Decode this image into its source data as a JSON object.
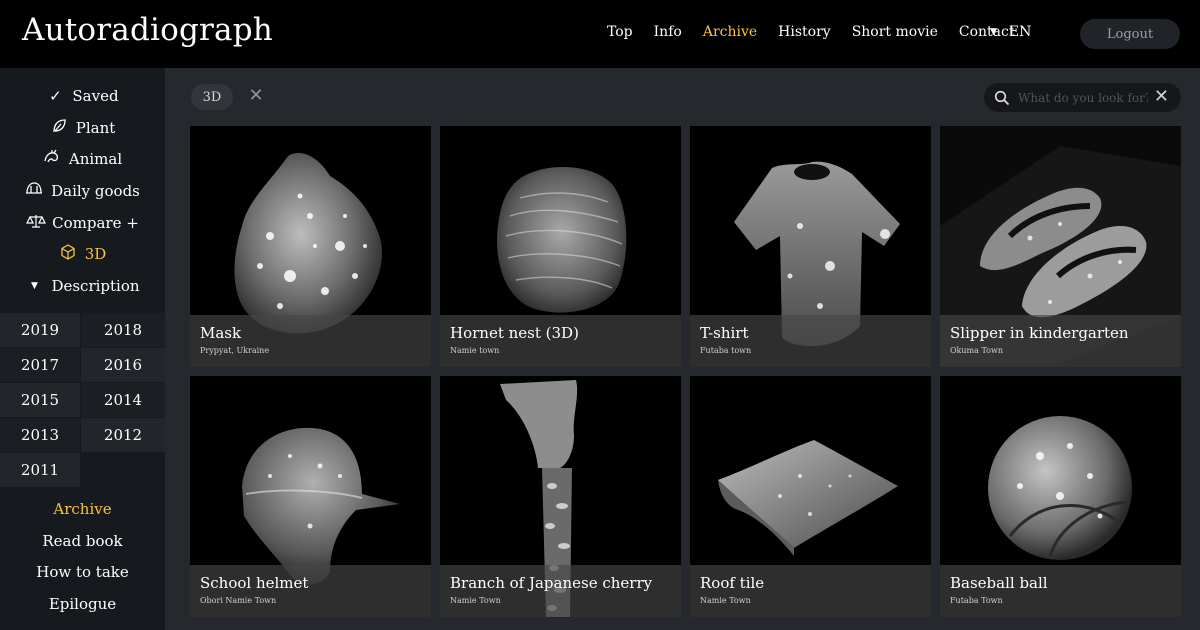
{
  "header": {
    "logo": "Autoradiograph",
    "nav": [
      "Top",
      "Info",
      "Archive",
      "History",
      "Short movie",
      "Contact"
    ],
    "active_nav": "Archive",
    "lang": "EN",
    "logout_label": "Logout"
  },
  "sidebar": {
    "menu": [
      {
        "label": "Saved",
        "icon": "check-icon"
      },
      {
        "label": "Plant",
        "icon": "leaf-icon"
      },
      {
        "label": "Animal",
        "icon": "animal-icon"
      },
      {
        "label": "Daily goods",
        "icon": "helmet-icon"
      },
      {
        "label": "Compare +",
        "icon": "scale-icon"
      },
      {
        "label": "3D",
        "icon": "cube-icon",
        "active": true
      },
      {
        "label": "Description",
        "icon": "triangle-down-icon"
      }
    ],
    "years": [
      "2019",
      "2018",
      "2017",
      "2016",
      "2015",
      "2014",
      "2013",
      "2012",
      "2011"
    ],
    "submenu": [
      {
        "label": "Archive",
        "active": true
      },
      {
        "label": "Read book"
      },
      {
        "label": "How to take"
      },
      {
        "label": "Epilogue"
      }
    ]
  },
  "main": {
    "filter_chip": "3D",
    "search_placeholder": "What do you look for?",
    "items": [
      {
        "title": "Mask",
        "location": "Prypyat, Ukraine",
        "art": "mask"
      },
      {
        "title": "Hornet nest (3D)",
        "location": "Namie town",
        "art": "nest"
      },
      {
        "title": "T-shirt",
        "location": "Futaba town",
        "art": "shirt"
      },
      {
        "title": "Slipper in kindergarten",
        "location": "Okuma Town",
        "art": "slipper"
      },
      {
        "title": "School helmet",
        "location": "Obori Namie Town",
        "art": "helmet"
      },
      {
        "title": "Branch of Japanese cherry",
        "location": "Namie Town",
        "art": "branch"
      },
      {
        "title": "Roof tile",
        "location": "Namie Town",
        "art": "tile"
      },
      {
        "title": "Baseball ball",
        "location": "Futaba Town",
        "art": "ball"
      }
    ]
  },
  "colors": {
    "accent": "#f5c542",
    "header_bg": "#000000",
    "main_bg": "#25282d",
    "sidebar_bg": "#16191d"
  }
}
